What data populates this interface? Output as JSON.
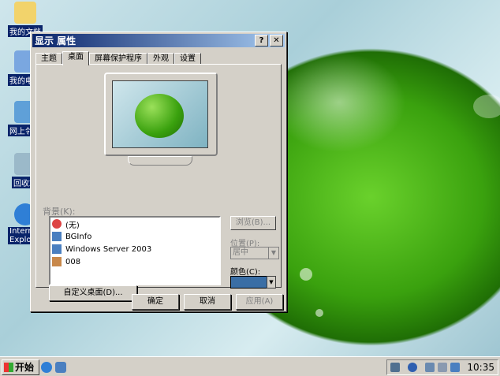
{
  "desktop": {
    "icons": [
      {
        "label": "我的文档"
      },
      {
        "label": "我的电脑"
      },
      {
        "label": "网上邻居"
      },
      {
        "label": "回收站"
      },
      {
        "label": "Internet Explorer"
      }
    ]
  },
  "dialog": {
    "title": "显示 属性",
    "help_button": "?",
    "close_button": "✕",
    "tabs": [
      {
        "label": "主题"
      },
      {
        "label": "桌面"
      },
      {
        "label": "屏幕保护程序"
      },
      {
        "label": "外观"
      },
      {
        "label": "设置"
      }
    ],
    "active_tab": "桌面",
    "background_label": "背景(K):",
    "background_items": [
      {
        "label": "(无)",
        "icon": "none-icon"
      },
      {
        "label": "BGInfo",
        "icon": "bitmap-icon"
      },
      {
        "label": "Windows Server 2003",
        "icon": "bitmap-icon"
      },
      {
        "label": "008",
        "icon": "image-icon"
      }
    ],
    "browse_button": "浏览(B)...",
    "position_label": "位置(P):",
    "position_value": "居中",
    "color_label": "颜色(C):",
    "customize_button": "自定义桌面(D)...",
    "ok_button": "确定",
    "cancel_button": "取消",
    "apply_button": "应用(A)"
  },
  "taskbar": {
    "start_label": "开始",
    "clock": "10:35"
  },
  "colors": {
    "title_start": "#0a246a",
    "title_end": "#a6caf0",
    "selected_color": "#3a6ea5"
  }
}
